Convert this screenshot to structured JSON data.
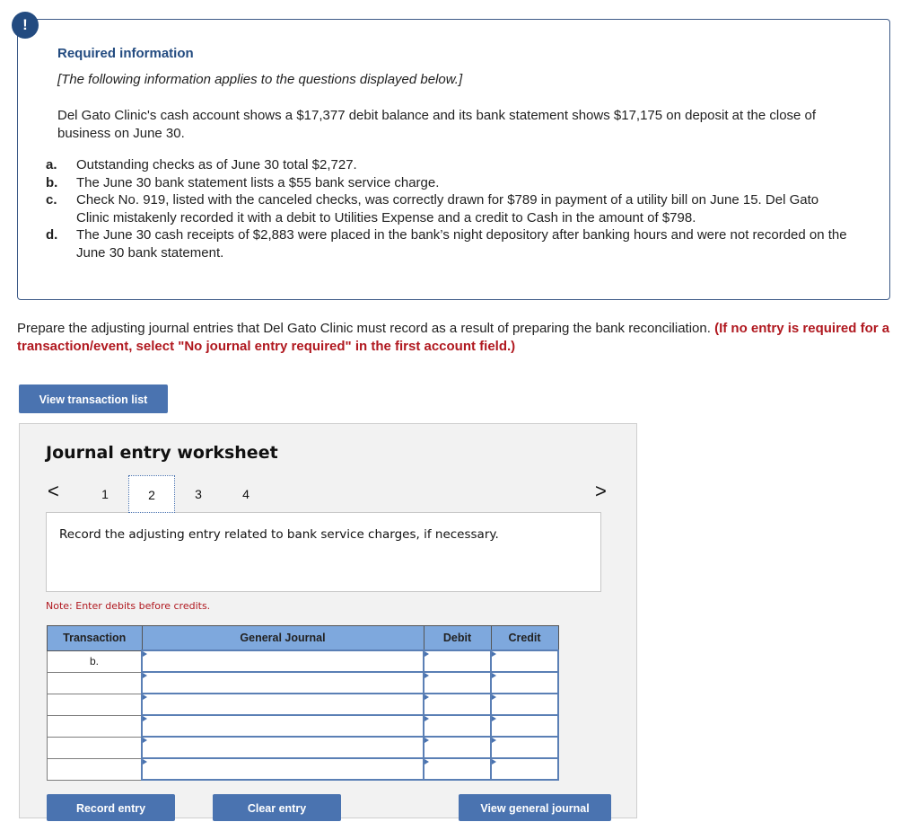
{
  "info": {
    "badge": "!",
    "title": "Required information",
    "subtitle": "[The following information applies to the questions displayed below.]",
    "paragraph": "Del Gato Clinic's cash account shows a $17,377 debit balance and its bank statement shows $17,175 on deposit at the close of business on June 30.",
    "items": [
      {
        "letter": "a.",
        "text": "Outstanding checks as of June 30 total $2,727."
      },
      {
        "letter": "b.",
        "text": "The June 30 bank statement lists a $55 bank service charge."
      },
      {
        "letter": "c.",
        "text": "Check No. 919, listed with the canceled checks, was correctly drawn for $789 in payment of a utility bill on June 15. Del Gato Clinic mistakenly recorded it with a debit to Utilities Expense and a credit to Cash in the amount of $798."
      },
      {
        "letter": "d.",
        "text": "The June 30 cash receipts of $2,883 were placed in the bank’s night depository after banking hours and were not recorded on the June 30 bank statement."
      }
    ]
  },
  "instructions": {
    "main": "Prepare the adjusting journal entries that Del Gato Clinic must record as a result of preparing the bank reconciliation. ",
    "emphasis": "(If no entry is required for a transaction/event, select \"No journal entry required\" in the first account field.)"
  },
  "buttons": {
    "view_transaction_list": "View transaction list",
    "record_entry": "Record entry",
    "clear_entry": "Clear entry",
    "view_general_journal": "View general journal"
  },
  "worksheet": {
    "title": "Journal entry worksheet",
    "prev_icon": "<",
    "next_icon": ">",
    "tabs": [
      "1",
      "2",
      "3",
      "4"
    ],
    "active_tab": "2",
    "prompt": "Record the adjusting entry related to bank service charges, if necessary.",
    "note": "Note: Enter debits before credits.",
    "table": {
      "headers": {
        "transaction": "Transaction",
        "general_journal": "General Journal",
        "debit": "Debit",
        "credit": "Credit"
      },
      "rows": [
        {
          "transaction": "b.",
          "account": "",
          "debit": "",
          "credit": ""
        },
        {
          "transaction": "",
          "account": "",
          "debit": "",
          "credit": ""
        },
        {
          "transaction": "",
          "account": "",
          "debit": "",
          "credit": ""
        },
        {
          "transaction": "",
          "account": "",
          "debit": "",
          "credit": ""
        },
        {
          "transaction": "",
          "account": "",
          "debit": "",
          "credit": ""
        },
        {
          "transaction": "",
          "account": "",
          "debit": "",
          "credit": ""
        }
      ]
    }
  }
}
